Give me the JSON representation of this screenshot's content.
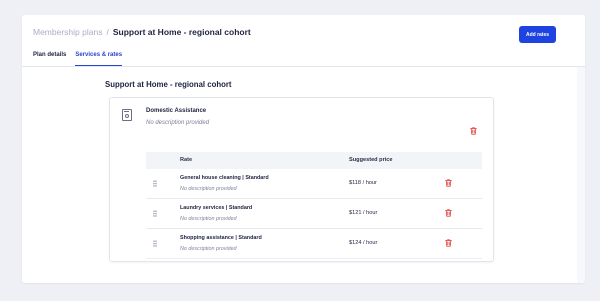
{
  "header": {
    "breadcrumb": {
      "parent": "Membership plans",
      "separator": "/",
      "current": "Support at Home - regional cohort"
    },
    "add_rates_label": "Add rates"
  },
  "tabs": [
    {
      "label": "Plan details",
      "active": false
    },
    {
      "label": "Services & rates",
      "active": true
    }
  ],
  "section": {
    "title": "Support at Home - regional cohort"
  },
  "service": {
    "icon": "washing-machine-icon",
    "name": "Domestic Assistance",
    "description": "No description provided",
    "table": {
      "headers": {
        "rate": "Rate",
        "price": "Suggested price"
      },
      "rows": [
        {
          "name": "General house cleaning | Standard",
          "description": "No description provided",
          "price": "$118 / hour"
        },
        {
          "name": "Laundry services | Standard",
          "description": "No description provided",
          "price": "$121 / hour"
        },
        {
          "name": "Shopping assistance | Standard",
          "description": "No description provided",
          "price": "$124 / hour"
        }
      ]
    }
  },
  "colors": {
    "accent": "#1f43e0",
    "danger": "#e0403a",
    "background": "#eef0f5"
  }
}
